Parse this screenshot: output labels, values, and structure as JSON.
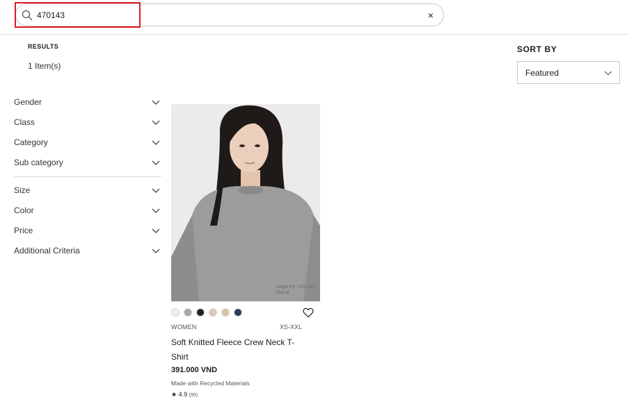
{
  "search": {
    "value": "470143",
    "clear_label": "×"
  },
  "results": {
    "label": "RESULTS",
    "count": "1 Item(s)"
  },
  "sort": {
    "label": "SORT BY",
    "selected": "Featured"
  },
  "filters": {
    "gender": "Gender",
    "class": "Class",
    "category": "Category",
    "sub_category": "Sub category",
    "size": "Size",
    "color": "Color",
    "price": "Price",
    "additional": "Additional Criteria"
  },
  "product": {
    "image_caption": "Height 5'9\" (175 cm)\nSize M",
    "swatch_colors": [
      "#f2efe8",
      "#a8a8a8",
      "#222222",
      "#e6c3c0",
      "#d8c2a6",
      "#283f5e"
    ],
    "gender": "WOMEN",
    "sizes": "XS-XXL",
    "name": "Soft Knitted Fleece Crew Neck T-Shirt",
    "price": "391.000 VND",
    "material": "Made with Recycled Materials",
    "rating": "4.9",
    "rating_count": "(95)"
  }
}
